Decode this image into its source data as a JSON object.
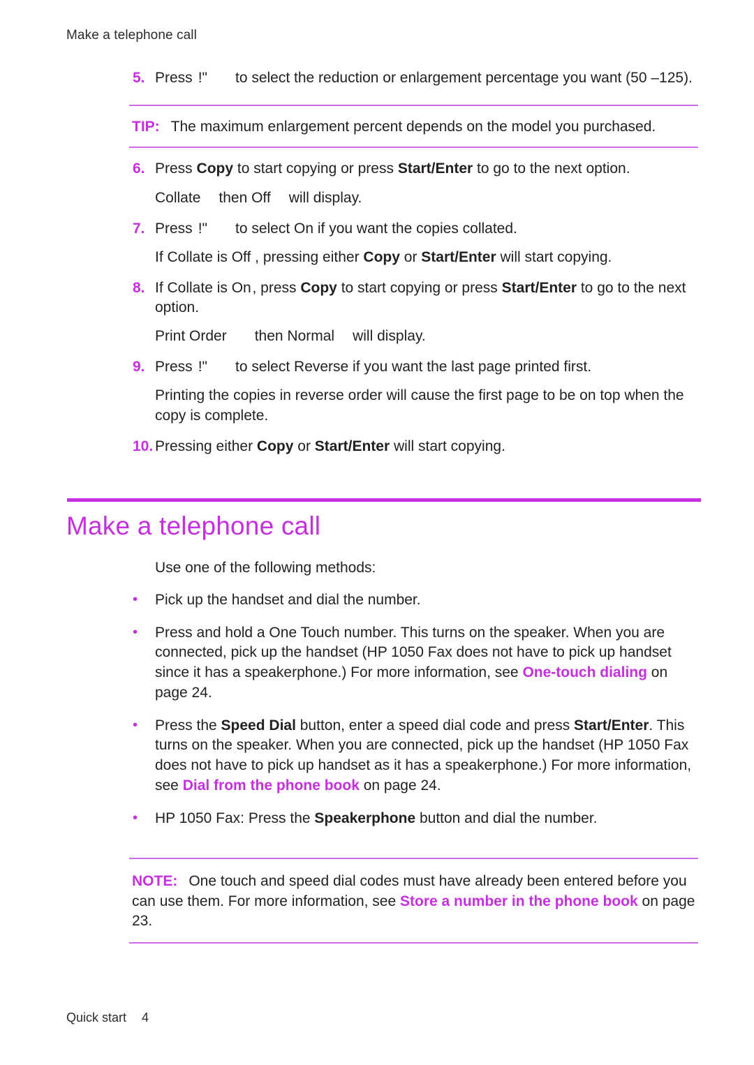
{
  "header": {
    "running_head": "Make a telephone call"
  },
  "colors": {
    "accent": "#c52fe0",
    "rule_light": "#d06ae8",
    "text": "#231f20"
  },
  "steps": [
    {
      "num": "5.",
      "pre": "Press",
      "symbol": "!\"",
      "post": "to select the reduction or enlargement percentage you want (50 –125)."
    },
    {
      "num": "6.",
      "text_a": "Press",
      "bold_a": "Copy",
      "text_b": "to start copying or press",
      "bold_b": "Start/Enter",
      "text_c": "to go to the next option.",
      "sub_a": "Collate",
      "sub_b": "then Off",
      "sub_c": "will display."
    },
    {
      "num": "7.",
      "pre": "Press",
      "symbol": "!\"",
      "post": "to select On  if you want the copies collated.",
      "cont_a": "If Collate is Off  , pressing either",
      "cont_bold_a": "Copy",
      "cont_b": "or",
      "cont_bold_b": "Start/Enter",
      "cont_c": "will start copying."
    },
    {
      "num": "8.",
      "text_a": "If Collate is On , press",
      "bold_a": "Copy",
      "text_b": "to start copying or press",
      "bold_b": "Start/Enter",
      "text_c": "to go to the next option.",
      "sub_a": "Print Order",
      "sub_b": "then Normal",
      "sub_c": "will display."
    },
    {
      "num": "9.",
      "pre": "Press",
      "symbol": "!\"",
      "post": "to select Reverse    if you want the last page printed first.",
      "cont_full": "Printing the copies in reverse order will cause the first page to be on top when the copy is complete."
    },
    {
      "num": "10.",
      "text_a": "Pressing either",
      "bold_a": "Copy",
      "text_b": "or",
      "bold_b": "Start/Enter",
      "text_c": "will start copying."
    }
  ],
  "tip": {
    "label": "TIP:",
    "text": "The maximum enlargement percent depends on the model you purchased."
  },
  "section": {
    "title": "Make a telephone call",
    "intro": "Use one of the following methods:"
  },
  "bullets": [
    {
      "marker": "•",
      "text_a": "Pick up the handset and dial the number."
    },
    {
      "marker": "•",
      "text_a": "Press and hold a One Touch number. This turns on the speaker. When you are connected, pick up the handset (HP 1050 Fax does not have to pick up handset since it has a speakerphone.) For more information, see ",
      "xref": "One-touch dialing",
      "text_b": " on page 24."
    },
    {
      "marker": "•",
      "text_a": "Press the ",
      "bold_a": "Speed Dial",
      "text_b": " button, enter a speed dial code and press ",
      "bold_b": "Start/Enter",
      "text_c": ". This turns on the speaker. When you are connected, pick up the handset (HP 1050 Fax does not have to pick up handset as it has a speakerphone.) For more information, see ",
      "xref": "Dial from the phone book",
      "text_d": " on page 24."
    },
    {
      "marker": "•",
      "text_a": "HP 1050 Fax: Press the ",
      "bold_a": "Speakerphone",
      "text_b": " button and dial the number."
    }
  ],
  "note": {
    "label": "NOTE:",
    "text_a": "One touch and speed dial codes must have already been entered before you can use them. For more information, see ",
    "xref": "Store a number in the phone book",
    "text_b": " on page 23."
  },
  "footer": {
    "chapter": "Quick start",
    "page": "4"
  }
}
